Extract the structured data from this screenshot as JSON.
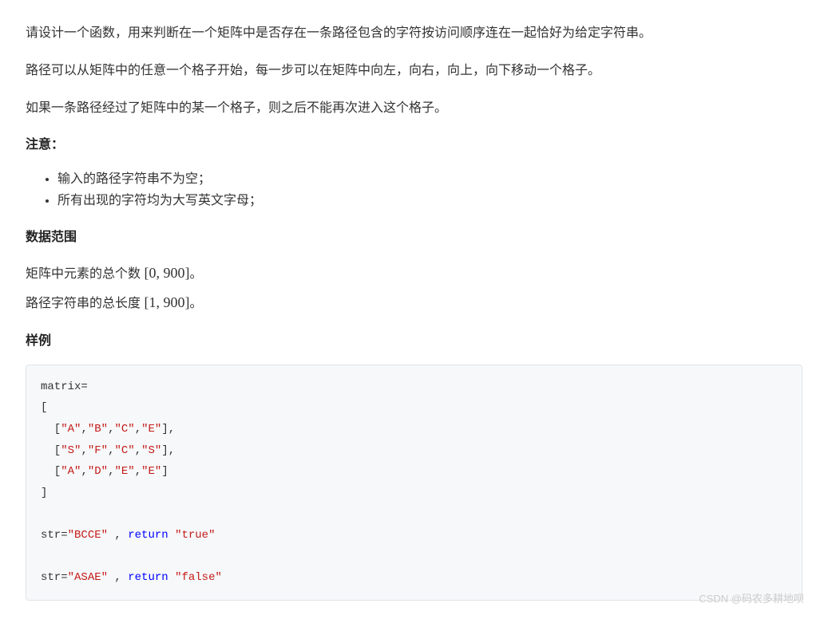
{
  "paragraphs": {
    "p1": "请设计一个函数，用来判断在一个矩阵中是否存在一条路径包含的字符按访问顺序连在一起恰好为给定字符串。",
    "p2": "路径可以从矩阵中的任意一个格子开始，每一步可以在矩阵中向左，向右，向上，向下移动一个格子。",
    "p3": "如果一条路径经过了矩阵中的某一个格子，则之后不能再次进入这个格子。"
  },
  "sections": {
    "notice_title": "注意：",
    "notice_items": [
      "输入的路径字符串不为空；",
      "所有出现的字符均为大写英文字母；"
    ],
    "data_range_title": "数据范围",
    "data_range_lines": {
      "line1_prefix": "矩阵中元素的总个数 ",
      "line1_range": "[0, 900]",
      "line1_suffix": "。",
      "line2_prefix": "路径字符串的总长度 ",
      "line2_range": "[1, 900]",
      "line2_suffix": "。"
    },
    "sample_title": "样例"
  },
  "code": {
    "matrix_keyword": "matrix=",
    "bracket_open": "[",
    "row1": {
      "indent": "  [",
      "a": "\"A\"",
      "b": "\"B\"",
      "c": "\"C\"",
      "d": "\"E\"",
      "close": "],"
    },
    "row2": {
      "indent": "  [",
      "a": "\"S\"",
      "b": "\"F\"",
      "c": "\"C\"",
      "d": "\"S\"",
      "close": "],"
    },
    "row3": {
      "indent": "  [",
      "a": "\"A\"",
      "b": "\"D\"",
      "c": "\"E\"",
      "d": "\"E\"",
      "close": "]"
    },
    "bracket_close": "]",
    "test1": {
      "prefix": "str=",
      "input": "\"BCCE\"",
      "sep": " , ",
      "return_kw": "return",
      "space": " ",
      "output": "\"true\""
    },
    "test2": {
      "prefix": "str=",
      "input": "\"ASAE\"",
      "sep": " , ",
      "return_kw": "return",
      "space": " ",
      "output": "\"false\""
    }
  },
  "watermark": "CSDN @码农多耕地呗"
}
